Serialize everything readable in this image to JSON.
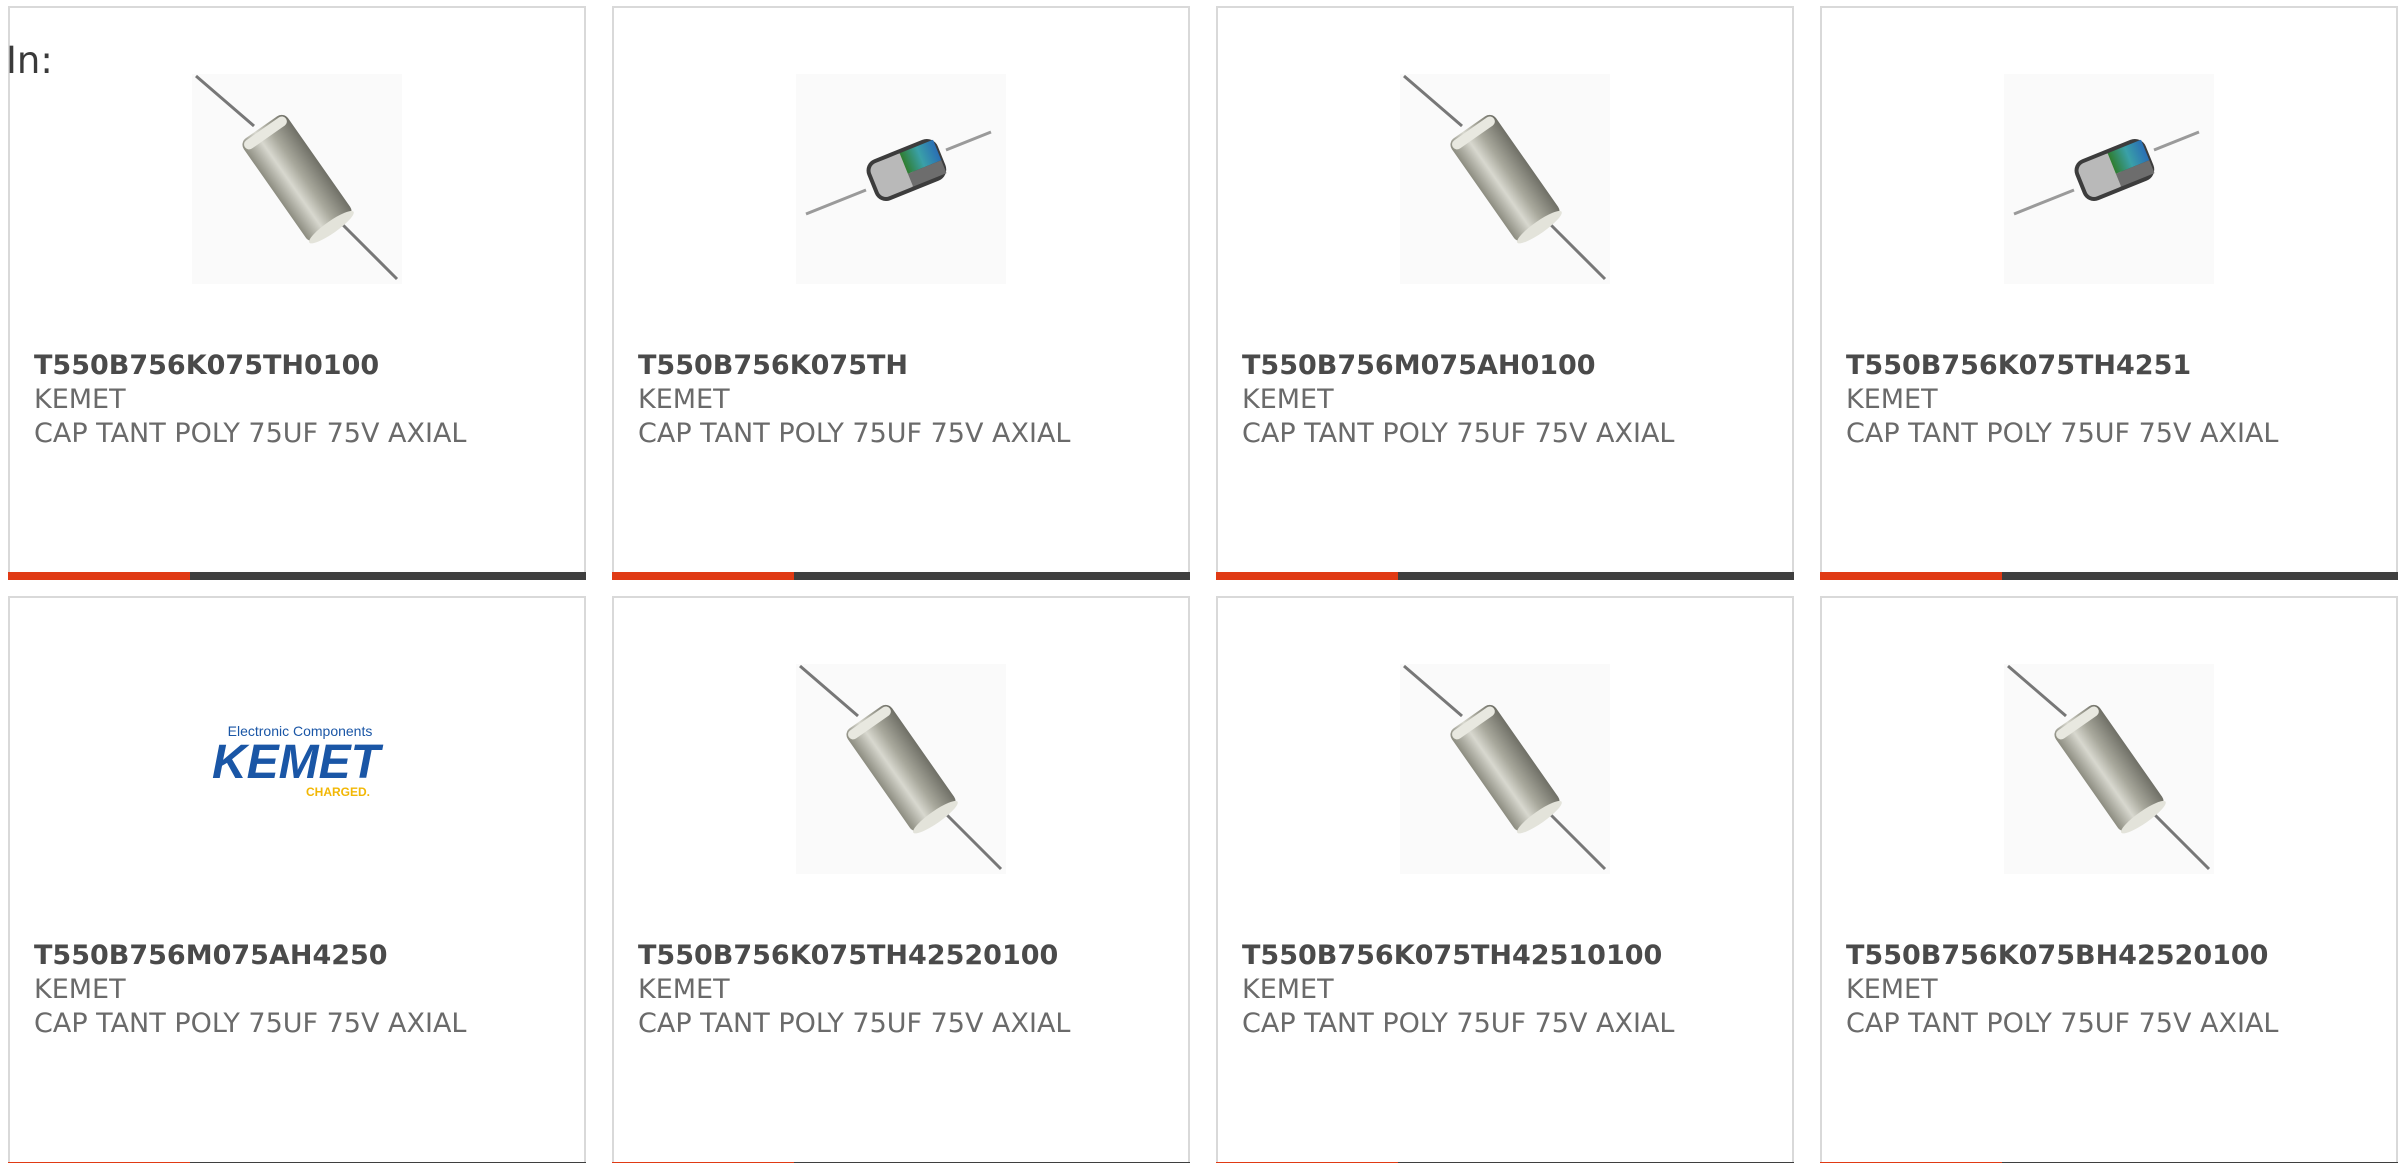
{
  "header": {
    "in_label": "In:"
  },
  "colors": {
    "accent_bar": "#e03a14",
    "bar": "#3f3f3f",
    "card_border": "#d9d9d9",
    "kemet_blue": "#1a56a6",
    "kemet_yellow": "#f2b705"
  },
  "products": [
    {
      "part_number": "T550B756K075TH0100",
      "manufacturer": "KEMET",
      "description": "CAP TANT POLY 75UF 75V AXIAL",
      "image": "axial-capacitor-icon"
    },
    {
      "part_number": "T550B756K075TH",
      "manufacturer": "KEMET",
      "description": "CAP TANT POLY 75UF 75V AXIAL",
      "image": "cutaway-capacitor-icon"
    },
    {
      "part_number": "T550B756M075AH0100",
      "manufacturer": "KEMET",
      "description": "CAP TANT POLY 75UF 75V AXIAL",
      "image": "axial-capacitor-icon"
    },
    {
      "part_number": "T550B756K075TH4251",
      "manufacturer": "KEMET",
      "description": "CAP TANT POLY 75UF 75V AXIAL",
      "image": "cutaway-capacitor-icon"
    },
    {
      "part_number": "T550B756M075AH4250",
      "manufacturer": "KEMET",
      "description": "CAP TANT POLY 75UF 75V AXIAL",
      "image": "kemet-logo",
      "logo": {
        "tagline": "Electronic Components",
        "name": "KEMET",
        "sub": "CHARGED."
      }
    },
    {
      "part_number": "T550B756K075TH42520100",
      "manufacturer": "KEMET",
      "description": "CAP TANT POLY 75UF 75V AXIAL",
      "image": "axial-capacitor-icon"
    },
    {
      "part_number": "T550B756K075TH42510100",
      "manufacturer": "KEMET",
      "description": "CAP TANT POLY 75UF 75V AXIAL",
      "image": "axial-capacitor-icon"
    },
    {
      "part_number": "T550B756K075BH42520100",
      "manufacturer": "KEMET",
      "description": "CAP TANT POLY 75UF 75V AXIAL",
      "image": "axial-capacitor-icon"
    }
  ]
}
